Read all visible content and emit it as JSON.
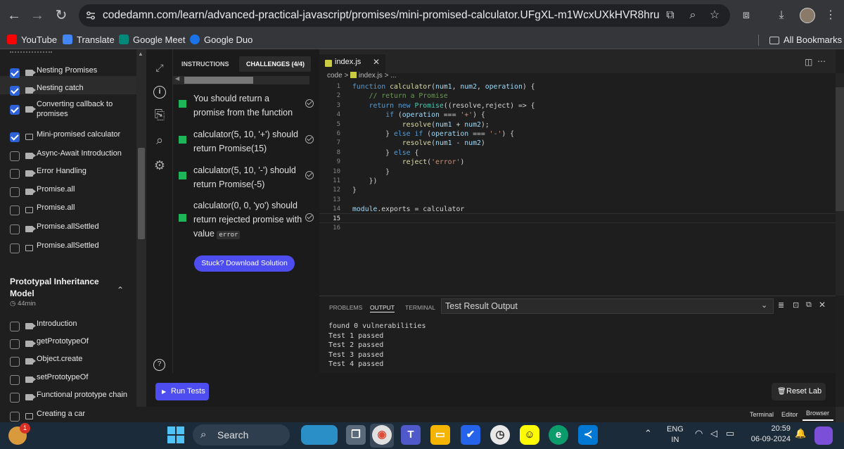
{
  "browser": {
    "url": "codedamn.com/learn/advanced-practical-javascript/promises/mini-promised-calculator.UFgXL-m1WcxUXkHVR8hru",
    "bookmarks": [
      "YouTube",
      "Translate",
      "Google Meet",
      "Google Duo"
    ],
    "all_bookmarks": "All Bookmarks",
    "icons": [
      "back-arrow-icon",
      "forward-arrow-icon",
      "reload-icon",
      "site-settings-icon",
      "install-app-icon",
      "zoom-icon",
      "star-icon",
      "extensions-icon",
      "download-icon",
      "profile-avatar",
      "menu-dots-icon"
    ]
  },
  "sidebar": {
    "lessons": [
      {
        "title": "Nesting Promises",
        "checked": true,
        "type": "video"
      },
      {
        "title": "Nesting catch",
        "checked": true,
        "type": "video"
      },
      {
        "title": "Converting callback to promises",
        "checked": true,
        "type": "video"
      },
      {
        "title": "Mini-promised calculator",
        "checked": true,
        "type": "doc",
        "active": true
      },
      {
        "title": "Async-Await Introduction",
        "checked": false,
        "type": "video"
      },
      {
        "title": "Error Handling",
        "checked": false,
        "type": "video"
      },
      {
        "title": "Promise.all",
        "checked": false,
        "type": "video"
      },
      {
        "title": "Promise.all",
        "checked": false,
        "type": "doc"
      },
      {
        "title": "Promise.allSettled",
        "checked": false,
        "type": "video"
      },
      {
        "title": "Promise.allSettled",
        "checked": false,
        "type": "doc"
      }
    ],
    "section": {
      "title": "Prototypal Inheritance Model",
      "duration": "44min"
    },
    "section_lessons": [
      {
        "title": "Introduction",
        "checked": false,
        "type": "video"
      },
      {
        "title": "getPrototypeOf",
        "checked": false,
        "type": "video"
      },
      {
        "title": "Object.create",
        "checked": false,
        "type": "video"
      },
      {
        "title": "setPrototypeOf",
        "checked": false,
        "type": "video"
      },
      {
        "title": "Functional prototype chain",
        "checked": false,
        "type": "video"
      },
      {
        "title": "Creating a car",
        "checked": false,
        "type": "doc"
      }
    ]
  },
  "instructions": {
    "tab_instructions": "INSTRUCTIONS",
    "tab_challenges": "CHALLENGES (4/4)",
    "tasks": [
      {
        "text": "You should return a promise from the function"
      },
      {
        "text": "calculator(5, 10, '+') should return Promise(15)"
      },
      {
        "text": "calculator(5, 10, '-') should return Promise(-5)"
      },
      {
        "text": "calculator(0, 0, 'yo') should return rejected promise with value",
        "code": "error"
      }
    ],
    "stuck_button": "Stuck? Download Solution"
  },
  "editor": {
    "tab": "index.js",
    "breadcrumb": [
      "code",
      ">",
      "index.js",
      ">",
      "..."
    ],
    "active_line": "15",
    "line_numbers": [
      "1",
      "2",
      "3",
      "4",
      "5",
      "6",
      "7",
      "8",
      "9",
      "10",
      "11",
      "12",
      "13",
      "14",
      "15",
      "16"
    ],
    "code": [
      "function calculator(num1, num2, operation) {",
      "    // return a Promise",
      "    return new Promise((resolve,reject) => {",
      "        if (operation === '+') {",
      "            resolve(num1 + num2);",
      "        } else if (operation === '-') {",
      "            resolve(num1 - num2)",
      "        } else {",
      "            reject('error')",
      "        }",
      "    })",
      "}",
      "",
      "module.exports = calculator",
      "",
      ""
    ]
  },
  "panel": {
    "tabs": [
      "PROBLEMS",
      "OUTPUT",
      "TERMINAL"
    ],
    "active_tab": "OUTPUT",
    "select": "Test Result Output",
    "output": [
      "found 0 vulnerabilities",
      "Test 1 passed",
      "Test 2 passed",
      "Test 3 passed",
      "Test 4 passed"
    ]
  },
  "actions": {
    "run_tests": "Run Tests",
    "reset_lab": "Reset Lab"
  },
  "layout_tabs": [
    "Terminal",
    "Editor",
    "Browser"
  ],
  "taskbar": {
    "search": "Search",
    "lang": "ENG",
    "region": "IN",
    "time": "20:59",
    "date": "06-09-2024",
    "badge": "1"
  },
  "colors": {
    "accent": "#4e4ef0",
    "check": "#2d62d9",
    "done": "#1db45a"
  }
}
